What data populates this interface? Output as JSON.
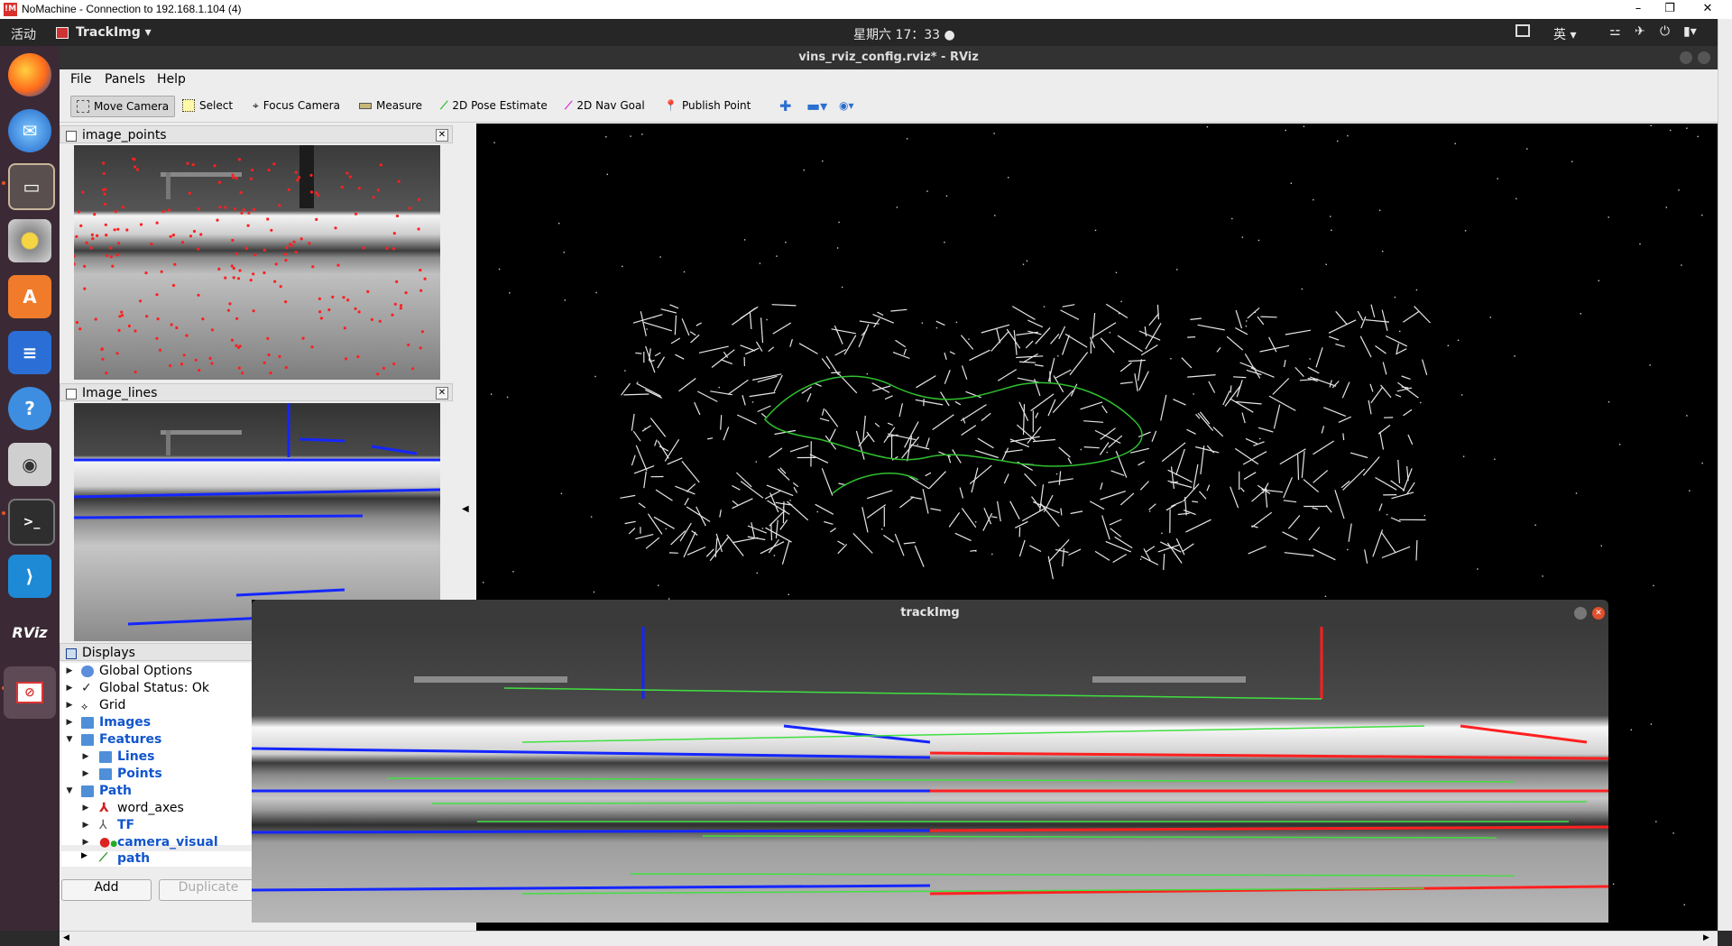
{
  "nomachine": {
    "title": "NoMachine - Connection to 192.168.1.104 (4)"
  },
  "topbar": {
    "activities": "活动",
    "app_menu": "TrackImg",
    "clock": "星期六 17：33",
    "input_method": "英"
  },
  "rviz": {
    "title": "vins_rviz_config.rviz* - RViz",
    "menu": [
      "File",
      "Panels",
      "Help"
    ],
    "tools": {
      "move_camera": "Move Camera",
      "select": "Select",
      "focus_camera": "Focus Camera",
      "measure": "Measure",
      "pose_estimate": "2D Pose Estimate",
      "nav_goal": "2D Nav Goal",
      "publish_point": "Publish Point"
    },
    "panels": {
      "image_points": "image_points",
      "image_lines": "Image_lines",
      "displays": "Displays"
    },
    "tree": [
      {
        "label": "Global Options",
        "state": "collapsed"
      },
      {
        "label": "Global Status: Ok",
        "state": "collapsed"
      },
      {
        "label": "Grid",
        "state": "collapsed"
      },
      {
        "label": "Images",
        "state": "collapsed"
      },
      {
        "label": "Features",
        "state": "expanded"
      },
      {
        "label": "Lines",
        "state": "collapsed"
      },
      {
        "label": "Points",
        "state": "collapsed"
      },
      {
        "label": "Path",
        "state": "expanded"
      },
      {
        "label": "word_axes",
        "state": "collapsed"
      },
      {
        "label": "TF",
        "state": "collapsed"
      },
      {
        "label": "camera_visual",
        "state": "collapsed"
      },
      {
        "label": "path",
        "state": "collapsed"
      }
    ],
    "buttons": {
      "add": "Add",
      "duplicate": "Duplicate"
    }
  },
  "trackimg": {
    "title": "trackImg"
  },
  "colors": {
    "feature_red": "#ff2020",
    "line_blue": "#1426ff",
    "path_green": "#30c030",
    "match_green": "#40e040",
    "accent": "#e95420"
  },
  "dock_icons": [
    "firefox-icon",
    "thunderbird-icon",
    "files-icon",
    "rhythmbox-icon",
    "software-center-icon",
    "writer-icon",
    "help-icon",
    "camera-icon",
    "terminal-icon",
    "vscode-icon",
    "rviz-icon",
    "nomachine-icon"
  ]
}
